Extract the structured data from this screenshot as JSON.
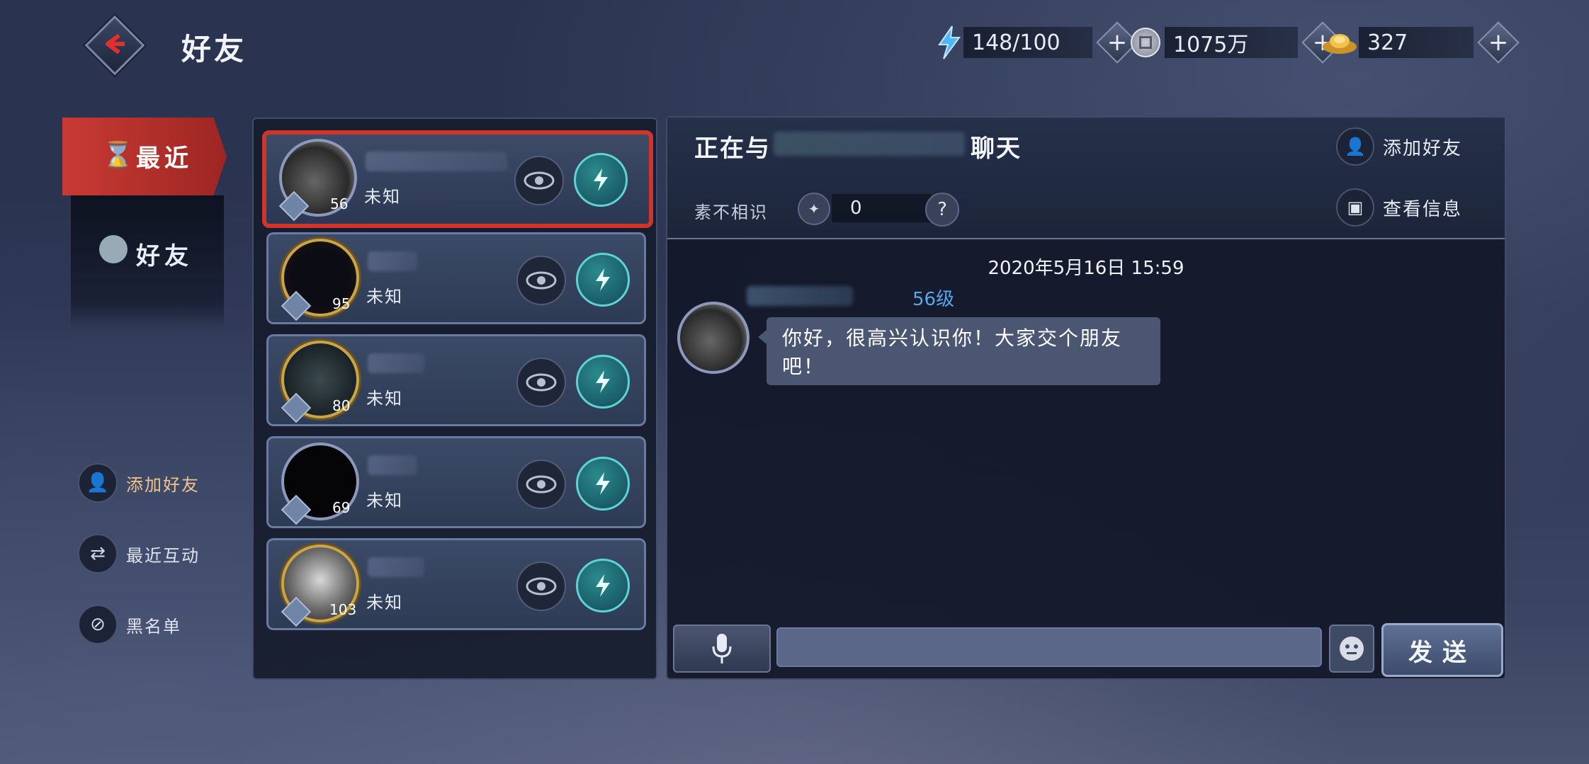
{
  "header": {
    "title": "好友",
    "stamina": "148/100",
    "coins": "1075万",
    "gold": "327"
  },
  "nav": {
    "recent": "最近",
    "friends": "好友"
  },
  "side_actions": {
    "add_friend": "添加好友",
    "recent_interaction": "最近互动",
    "blacklist": "黑名单"
  },
  "friends": [
    {
      "level": "56",
      "status": "未知",
      "active": true
    },
    {
      "level": "95",
      "status": "未知"
    },
    {
      "level": "80",
      "status": "未知"
    },
    {
      "level": "69",
      "status": "未知"
    },
    {
      "level": "103",
      "status": "未知"
    }
  ],
  "chat": {
    "with_prefix": "正在与",
    "with_suffix": "聊天",
    "relation_label": "素不相识",
    "relation_value": "0",
    "relation_help": "?",
    "add_friend": "添加好友",
    "view_info": "查看信息",
    "timestamp": "2020年5月16日 15:59",
    "message": {
      "level": "56级",
      "text": "你好，很高兴认识你！大家交个朋友吧！"
    },
    "send": "发送"
  },
  "colors": {
    "accent_red": "#d0352c",
    "teal": "#5fd2d6",
    "level_blue": "#5aa6ea",
    "panel": "#1c2539"
  }
}
